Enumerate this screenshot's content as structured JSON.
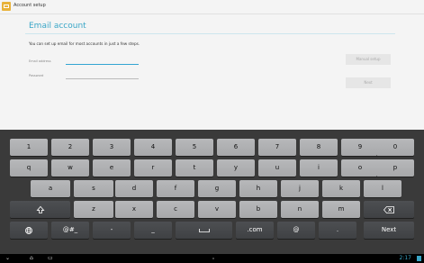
{
  "titlebar": {
    "title": "Account setup"
  },
  "form": {
    "heading": "Email account",
    "intro": "You can set up email for most accounts in just a few steps.",
    "email_label": "Email address",
    "email_value": "",
    "password_label": "Password",
    "password_value": "",
    "manual_setup_label": "Manual setup",
    "next_label": "Next"
  },
  "keyboard": {
    "row1": [
      "1",
      "2",
      "3",
      "4",
      "5",
      "6",
      "7",
      "8",
      "9",
      "0"
    ],
    "row2": [
      "q",
      "w",
      "e",
      "r",
      "t",
      "y",
      "u",
      "i",
      "o",
      "p"
    ],
    "row3": [
      "a",
      "s",
      "d",
      "f",
      "g",
      "h",
      "j",
      "k",
      "l"
    ],
    "row4": [
      "z",
      "x",
      "c",
      "v",
      "b",
      "n",
      "m"
    ],
    "symbols_label": "@#_",
    "hyphen_label": "-",
    "underscore_label": "_",
    "dotcom_label": ".com",
    "at_label": "@",
    "period_label": ".",
    "next_label": "Next"
  },
  "navbar": {
    "clock": "2:17"
  }
}
